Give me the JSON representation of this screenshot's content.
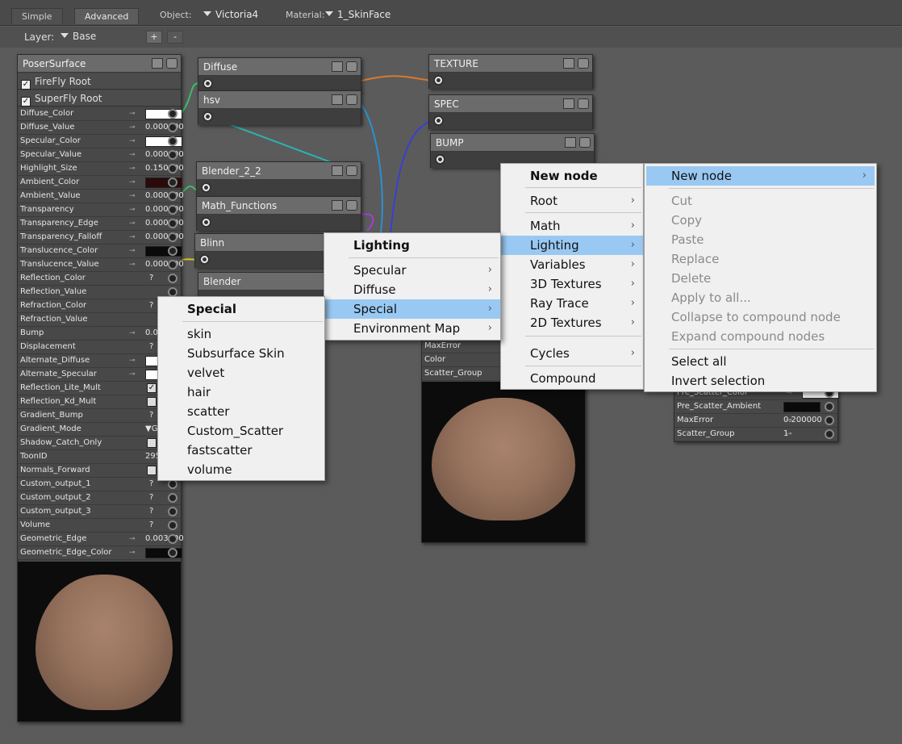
{
  "tabs": [
    {
      "label": "Simple",
      "active": false
    },
    {
      "label": "Advanced",
      "active": true
    }
  ],
  "object": {
    "label": "Object:",
    "value": "Victoria4"
  },
  "material": {
    "label": "Material:",
    "value": "1_SkinFace"
  },
  "layer": {
    "label": "Layer:",
    "value": "Base",
    "add_label": "+",
    "remove_label": "-"
  },
  "poser_surface": {
    "title": "PoserSurface",
    "roots": [
      "FireFly Root",
      "SuperFly Root"
    ],
    "params": [
      {
        "name": "Diffuse_Color",
        "kind": "color",
        "color": "#ffffff"
      },
      {
        "name": "Diffuse_Value",
        "kind": "num",
        "value": "0.000000"
      },
      {
        "name": "Specular_Color",
        "kind": "color",
        "color": "#ffffff"
      },
      {
        "name": "Specular_Value",
        "kind": "num",
        "value": "0.000000"
      },
      {
        "name": "Highlight_Size",
        "kind": "num",
        "value": "0.150000"
      },
      {
        "name": "Ambient_Color",
        "kind": "color",
        "color": "#2a0a0a"
      },
      {
        "name": "Ambient_Value",
        "kind": "num",
        "value": "0.000000"
      },
      {
        "name": "Transparency",
        "kind": "num",
        "value": "0.000000"
      },
      {
        "name": "Transparency_Edge",
        "kind": "num",
        "value": "0.000000"
      },
      {
        "name": "Transparency_Falloff",
        "kind": "num",
        "value": "0.000000"
      },
      {
        "name": "Translucence_Color",
        "kind": "color",
        "color": "#0a0a0a"
      },
      {
        "name": "Translucence_Value",
        "kind": "num",
        "value": "0.000000"
      },
      {
        "name": "Reflection_Color",
        "kind": "q",
        "value": "?"
      },
      {
        "name": "Reflection_Value",
        "kind": "none"
      },
      {
        "name": "Refraction_Color",
        "kind": "q",
        "value": "?"
      },
      {
        "name": "Refraction_Value",
        "kind": "none"
      },
      {
        "name": "Bump",
        "kind": "num",
        "value": "0.00400"
      },
      {
        "name": "Displacement",
        "kind": "q",
        "value": "?"
      },
      {
        "name": "Alternate_Diffuse",
        "kind": "color",
        "color": "#ffffff"
      },
      {
        "name": "Alternate_Specular",
        "kind": "color",
        "color": "#ffffff"
      },
      {
        "name": "Reflection_Lite_Mult",
        "kind": "check",
        "checked": true
      },
      {
        "name": "Reflection_Kd_Mult",
        "kind": "check",
        "checked": false
      },
      {
        "name": "Gradient_Bump",
        "kind": "q",
        "value": "?"
      },
      {
        "name": "Gradient_Mode",
        "kind": "select",
        "value": "Grad"
      },
      {
        "name": "Shadow_Catch_Only",
        "kind": "check",
        "checked": false
      },
      {
        "name": "ToonID",
        "kind": "plain",
        "value": "295"
      },
      {
        "name": "Normals_Forward",
        "kind": "check",
        "checked": false
      },
      {
        "name": "Custom_output_1",
        "kind": "q",
        "value": "?"
      },
      {
        "name": "Custom_output_2",
        "kind": "q",
        "value": "?"
      },
      {
        "name": "Custom_output_3",
        "kind": "q",
        "value": "?"
      },
      {
        "name": "Volume",
        "kind": "q",
        "value": "?"
      },
      {
        "name": "Geometric_Edge",
        "kind": "num",
        "value": "0.003000"
      },
      {
        "name": "Geometric_Edge_Color",
        "kind": "color",
        "color": "#0a0a0a"
      }
    ]
  },
  "nodes": {
    "diffuse": "Diffuse",
    "hsv": "hsv",
    "blender": "Blender_2_2",
    "math": "Math_Functions",
    "blinn": "Blinn",
    "blender2": "Blender",
    "texture": "TEXTURE",
    "spec": "SPEC",
    "bump": "BUMP"
  },
  "mid_panel_rows": [
    "MaxError",
    "Color",
    "Scatter_Group"
  ],
  "right_panel_rows": [
    {
      "name": "Pre_Scatter_Color",
      "value": ""
    },
    {
      "name": "Pre_Scatter_Ambient",
      "value": ""
    },
    {
      "name": "MaxError",
      "value": "0.200000"
    },
    {
      "name": "Scatter_Group",
      "value": "1"
    }
  ],
  "menu_main": {
    "header": "New node",
    "items": [
      "Root",
      "Math",
      "Lighting",
      "Variables",
      "3D Textures",
      "Ray Trace",
      "2D Textures",
      "Cycles",
      "Compound"
    ]
  },
  "menu_lighting": {
    "header": "Lighting",
    "items": [
      "Specular",
      "Diffuse",
      "Special",
      "Environment Map"
    ]
  },
  "menu_special": {
    "header": "Special",
    "items": [
      "skin",
      "Subsurface Skin",
      "velvet",
      "hair",
      "scatter",
      "Custom_Scatter",
      "fastscatter",
      "volume"
    ]
  },
  "menu_context": {
    "items": [
      "New node",
      "Cut",
      "Copy",
      "Paste",
      "Replace",
      "Delete",
      "Apply to all...",
      "Collapse to compound node",
      "Expand compound nodes",
      "Select all",
      "Invert selection"
    ]
  }
}
